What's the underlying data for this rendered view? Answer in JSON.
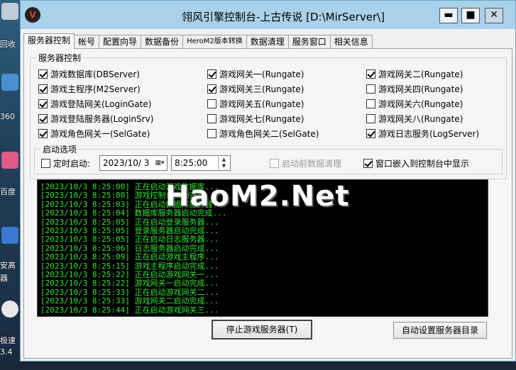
{
  "desktop": {
    "labels": [
      "回收",
      "360",
      "百度",
      "安高",
      "器",
      "极速",
      "3.4"
    ]
  },
  "window": {
    "title": "翎风引擎控制台-上古传说 [D:\\MirServer\\]",
    "app_icon_glyph": "V",
    "min_glyph": "▬",
    "max_glyph": "■",
    "close_glyph": "✕"
  },
  "tabs": [
    "服务器控制",
    "帐号",
    "配置向导",
    "数据备份",
    "HeroM2版本转换",
    "数据清理",
    "服务窗口",
    "相关信息"
  ],
  "server_control": {
    "group_title": "服务器控制",
    "checkboxes": [
      {
        "label": "游戏数据库(DBServer)",
        "checked": true
      },
      {
        "label": "游戏网关一(Rungate)",
        "checked": true
      },
      {
        "label": "游戏网关二(Rungate)",
        "checked": true
      },
      {
        "label": "游戏主程序(M2Server)",
        "checked": true
      },
      {
        "label": "游戏网关三(Rungate)",
        "checked": true
      },
      {
        "label": "游戏网关四(Rungate)",
        "checked": false
      },
      {
        "label": "游戏登陆网关(LoginGate)",
        "checked": true
      },
      {
        "label": "游戏网关五(Rungate)",
        "checked": false
      },
      {
        "label": "游戏网关六(Rungate)",
        "checked": false
      },
      {
        "label": "游戏登陆服务器(LoginSrv)",
        "checked": true
      },
      {
        "label": "游戏网关七(Rungate)",
        "checked": false
      },
      {
        "label": "游戏网关八(Rungate)",
        "checked": false
      },
      {
        "label": "游戏角色网关一(SelGate)",
        "checked": true
      },
      {
        "label": "游戏角色网关二(SelGate)",
        "checked": false
      },
      {
        "label": "游戏日志服务(LogServer)",
        "checked": true
      }
    ]
  },
  "start_options": {
    "group_title": "启动选项",
    "timed_start_label": "定时启动:",
    "timed_start_checked": false,
    "date_value": "2023/10/ 3",
    "time_value": "8:25:00",
    "cleanup_label": "启动前数据清理",
    "cleanup_checked": false,
    "embed_label": "窗口嵌入到控制台中显示",
    "embed_checked": true
  },
  "log": {
    "watermark": "HaoM2.Net",
    "lines": [
      "[2023/10/3 8:25:00] 正在启动游戏数据库...",
      "[2023/10/3 8:25:00] 游戏控制台启动完成...",
      "[2023/10/3 8:25:03] 正在启动数据库服务器...",
      "[2023/10/3 8:25:04] 数据库服务器启动完成...",
      "[2023/10/3 8:25:05] 正在启动登录服务器...",
      "[2023/10/3 8:25:05] 登录服务器启动完成...",
      "[2023/10/3 8:25:05] 正在启动日志服务器...",
      "[2023/10/3 8:25:06] 日志服务器启动完成...",
      "[2023/10/3 8:25:09] 正在启动游戏主程序...",
      "[2023/10/3 8:25:15] 游戏主程序启动完成...",
      "[2023/10/3 8:25:22] 正在启动游戏网关一...",
      "[2023/10/3 8:25:22] 游戏网关一启动完成...",
      "[2023/10/3 8:25:33] 正在启动游戏网关二...",
      "[2023/10/3 8:25:33] 游戏网关二启动完成...",
      "[2023/10/3 8:25:44] 正在启动游戏网关三..."
    ]
  },
  "buttons": {
    "stop": "停止游戏服务器(T)",
    "auto_dir": "自动设置服务器目录"
  }
}
